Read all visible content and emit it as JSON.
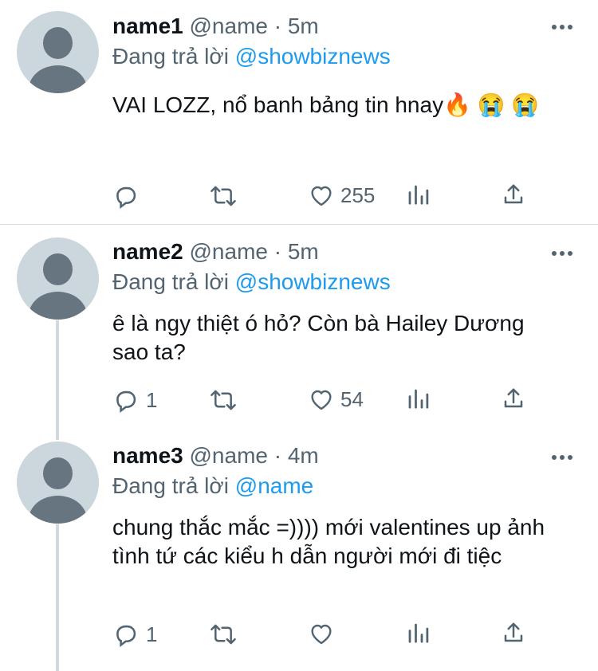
{
  "tweets": [
    {
      "name": "name1",
      "handle": "@name",
      "time": "· 5m",
      "reply_prefix": "Đang trả lời",
      "reply_to": "@showbiznews",
      "text": "VAI LOZZ, nổ banh bảng tin hnay🔥 😭 😭",
      "replies": "",
      "retweets": "",
      "likes": "255"
    },
    {
      "name": "name2",
      "handle": "@name",
      "time": "· 5m",
      "reply_prefix": "Đang trả lời",
      "reply_to": "@showbiznews",
      "text": "ê là ngy thiệt ó hỏ? Còn bà Hailey Dương sao ta?",
      "replies": "1",
      "retweets": "",
      "likes": "54"
    },
    {
      "name": "name3",
      "handle": "@name",
      "time": "· 4m",
      "reply_prefix": "Đang trả lời",
      "reply_to": "@name",
      "text": "chung thắc mắc =)))) mới valentines up ảnh tình tứ các kiểu h dẫn người mới đi tiệc",
      "replies": "1",
      "retweets": "",
      "likes": ""
    }
  ],
  "colors": {
    "link": "#1d9bf0",
    "secondary_text": "#536471",
    "avatar_bg": "#ccd6dd",
    "thread_line": "#cfd9de"
  },
  "icons": [
    "more-icon",
    "reply-icon",
    "retweet-icon",
    "like-icon",
    "analytics-icon",
    "share-icon"
  ]
}
